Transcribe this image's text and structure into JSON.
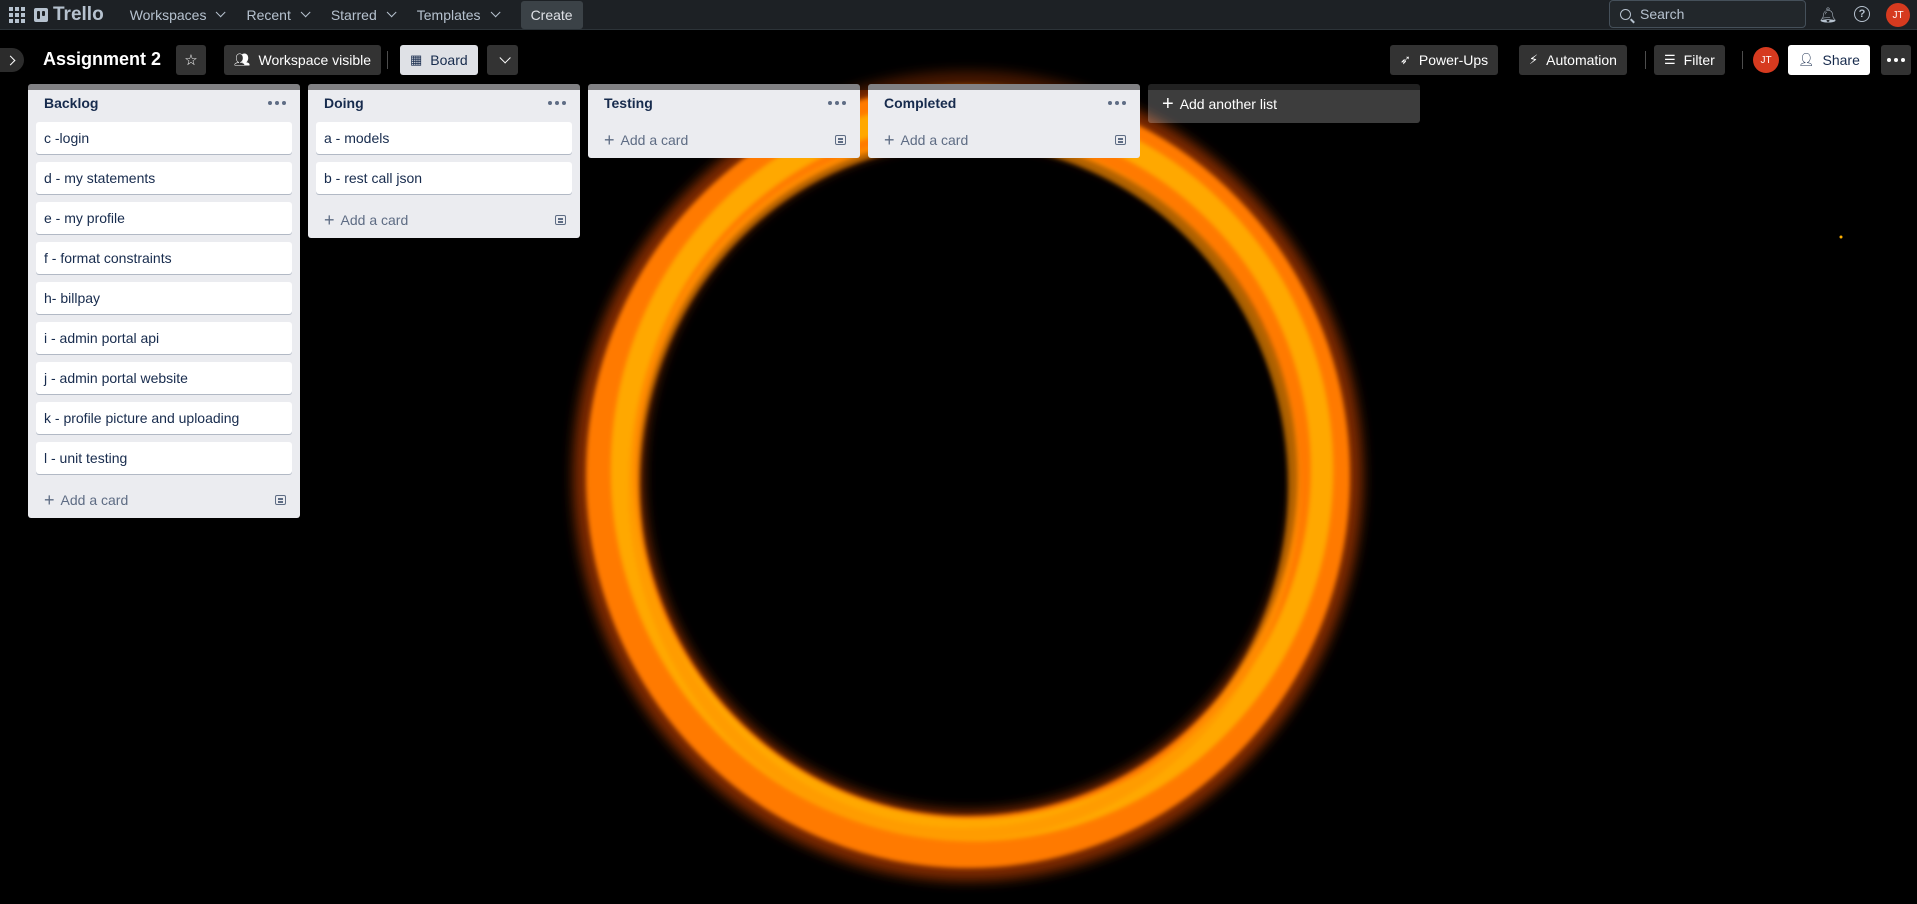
{
  "nav": {
    "logo": "Trello",
    "menus": [
      "Workspaces",
      "Recent",
      "Starred",
      "Templates"
    ],
    "create": "Create",
    "search_placeholder": "Search",
    "avatar": "JT"
  },
  "board": {
    "title": "Assignment 2",
    "visibility": "Workspace visible",
    "view": "Board",
    "powerups": "Power-Ups",
    "automation": "Automation",
    "filter": "Filter",
    "avatar": "JT",
    "share": "Share"
  },
  "lists": [
    {
      "title": "Backlog",
      "cards": [
        "c -login",
        "d - my statements",
        "e - my profile",
        "f - format constraints",
        "h- billpay",
        "i - admin portal api",
        "j - admin portal website",
        "k - profile picture and uploading",
        "l - unit testing"
      ],
      "add": "Add a card"
    },
    {
      "title": "Doing",
      "cards": [
        "a - models",
        "b - rest call json"
      ],
      "add": "Add a card"
    },
    {
      "title": "Testing",
      "cards": [],
      "add": "Add a card"
    },
    {
      "title": "Completed",
      "cards": [],
      "add": "Add a card"
    }
  ],
  "add_list": "Add another list",
  "colors": {
    "nav_bg": "#1d2125",
    "list_bg": "#ebecf0",
    "accent_avatar": "#d63a1f",
    "fire": "#ff8c00"
  }
}
